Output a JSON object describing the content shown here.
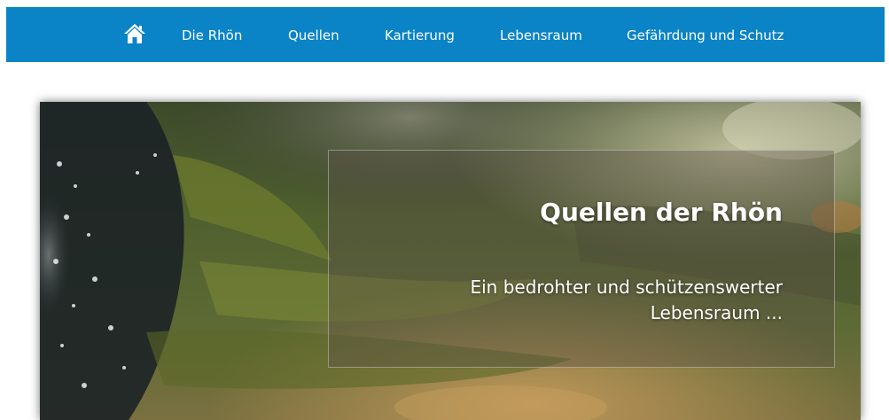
{
  "nav": {
    "home_icon": "home-icon",
    "items": [
      {
        "label": "Die Rhön"
      },
      {
        "label": "Quellen"
      },
      {
        "label": "Kartierung"
      },
      {
        "label": "Lebensraum"
      },
      {
        "label": "Gefährdung und Schutz"
      }
    ]
  },
  "hero": {
    "title": "Quellen der Rhön",
    "subtitle": "Ein bedrohter und schützenswerter Lebensraum ..."
  },
  "colors": {
    "nav_background": "#0a84c6",
    "nav_text": "#ffffff",
    "hero_text": "#ffffff"
  }
}
